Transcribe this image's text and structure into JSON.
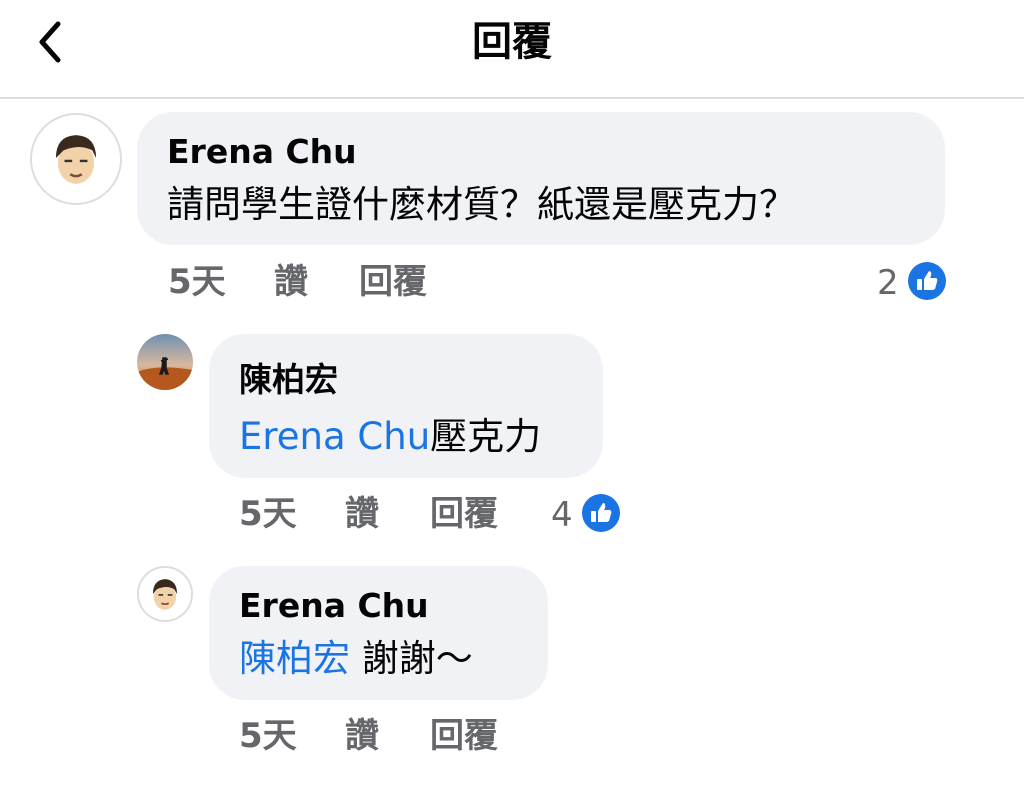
{
  "header": {
    "title": "回覆",
    "back_icon": "chevron-left-icon"
  },
  "comments": [
    {
      "author": "Erena Chu",
      "text": "請問學生證什麼材質？紙還是壓克力？",
      "time": "5天",
      "like_label": "讚",
      "reply_label": "回覆",
      "like_count": "2"
    },
    {
      "author": "陳柏宏",
      "mention": "Erena Chu",
      "text": "壓克力",
      "time": "5天",
      "like_label": "讚",
      "reply_label": "回覆",
      "like_count": "4"
    },
    {
      "author": "Erena Chu",
      "mention": "陳柏宏",
      "text": " 謝謝～",
      "time": "5天",
      "like_label": "讚",
      "reply_label": "回覆"
    }
  ],
  "colors": {
    "mention": "#1b74e4",
    "like_icon": "#1b74e4",
    "bubble": "#f0f2f5",
    "secondary_text": "#65676b"
  }
}
